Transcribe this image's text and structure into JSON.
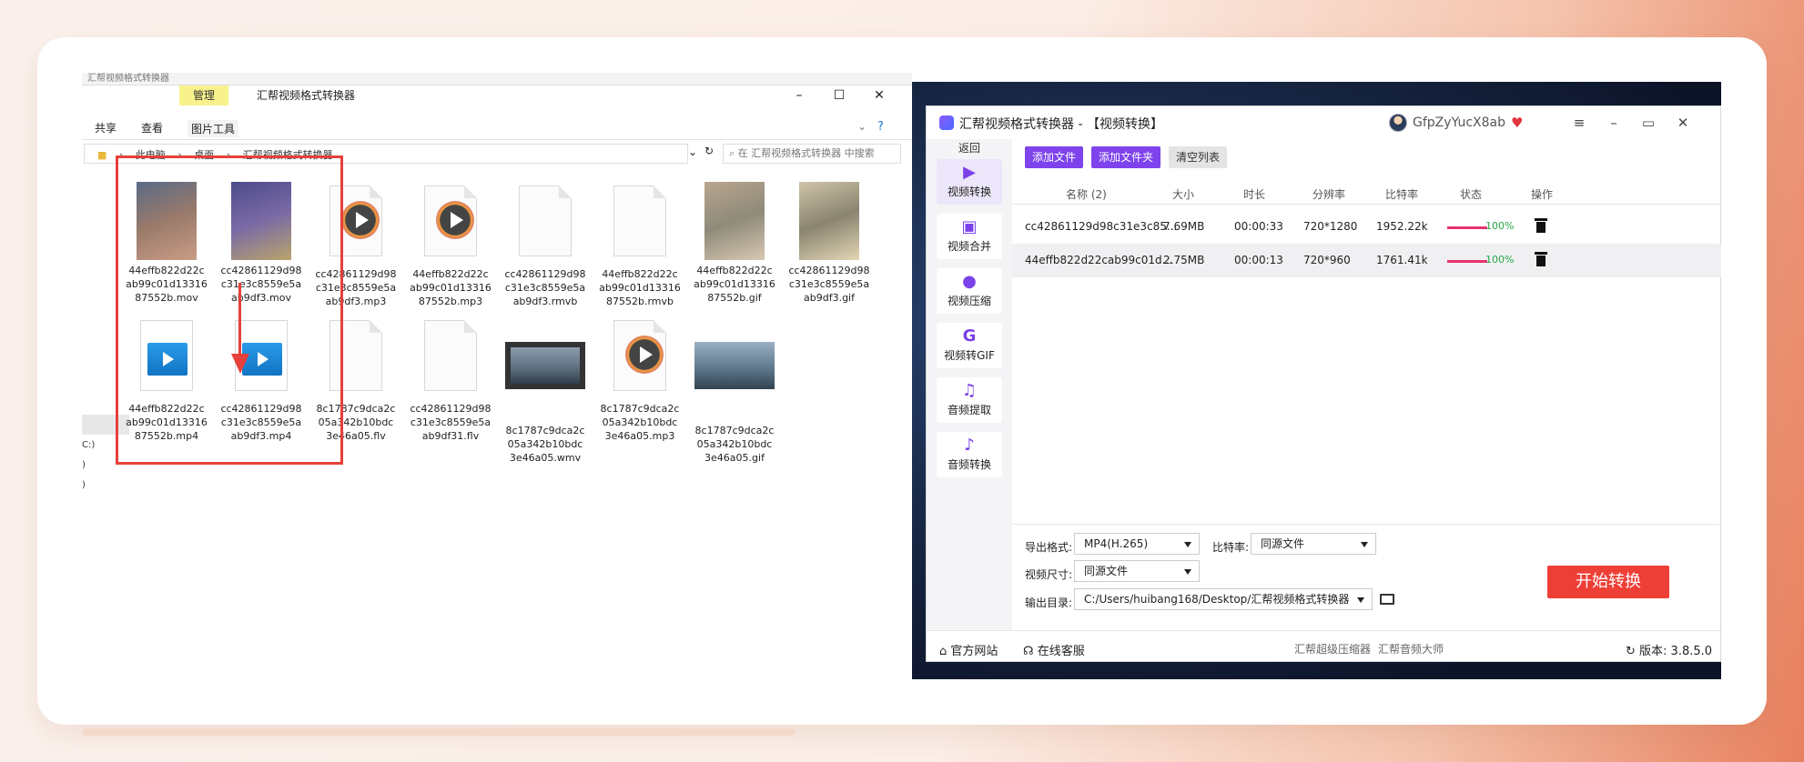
{
  "explorer": {
    "top_fragment": "汇帮视频格式转换器",
    "tab_manage": "管理",
    "title": "汇帮视频格式转换器",
    "ribbon": [
      "共享",
      "查看",
      "图片工具"
    ],
    "address": [
      "此电脑",
      "桌面",
      "汇帮视频格式转换器"
    ],
    "search_placeholder": "在 汇帮视频格式转换器 中搜索",
    "side_fragments": [
      "C:)",
      ")",
      ")"
    ],
    "files": [
      {
        "name": "44effb822d22cab99c01d1331687552b.mov",
        "lines": [
          "44effb822d22c",
          "ab99c01d13316",
          "87552b.mov"
        ],
        "kind": "photo",
        "colors": [
          "#5a6b86",
          "#9a7a6a",
          "#c99d86"
        ]
      },
      {
        "name": "cc42861129d98c31e3c8559e5aab9df3.mov",
        "lines": [
          "cc42861129d98",
          "c31e3c8559e5a",
          "ab9df3.mov"
        ],
        "kind": "photo",
        "colors": [
          "#4d4b8a",
          "#7a6aa6",
          "#b9a46a"
        ]
      },
      {
        "name": "cc42861129d98c31e3c8559e5aab9df3.mp3",
        "lines": [
          "cc42861129d98",
          "c31e3c8559e5a",
          "ab9df3.mp3"
        ],
        "kind": "play"
      },
      {
        "name": "44effb822d22cab99c01d1331687552b.mp3",
        "lines": [
          "44effb822d22c",
          "ab99c01d13316",
          "87552b.mp3"
        ],
        "kind": "play"
      },
      {
        "name": "cc42861129d98c31e3c8559e5aab9df3.rmvb",
        "lines": [
          "cc42861129d98",
          "c31e3c8559e5a",
          "ab9df3.rmvb"
        ],
        "kind": "doc"
      },
      {
        "name": "44effb822d22cab99c01d1331687552b.rmvb",
        "lines": [
          "44effb822d22c",
          "ab99c01d13316",
          "87552b.rmvb"
        ],
        "kind": "doc"
      },
      {
        "name": "44effb822d22cab99c01d1331687552b.gif",
        "lines": [
          "44effb822d22c",
          "ab99c01d13316",
          "87552b.gif"
        ],
        "kind": "photo",
        "colors": [
          "#b9a68e",
          "#8f8a7a",
          "#d8c8b2"
        ]
      },
      {
        "name": "cc42861129d98c31e3c8559e5aab9df3.gif",
        "lines": [
          "cc42861129d98",
          "c31e3c8559e5a",
          "ab9df3.gif"
        ],
        "kind": "photo",
        "colors": [
          "#cfc4a8",
          "#8a8470",
          "#e3d6b5"
        ]
      },
      {
        "name": "44effb822d22cab99c01d1331687552b.mp4",
        "lines": [
          "44effb822d22c",
          "ab99c01d13316",
          "87552b.mp4"
        ],
        "kind": "mp4"
      },
      {
        "name": "cc42861129d98c31e3c8559e5aab9df3.mp4",
        "lines": [
          "cc42861129d98",
          "c31e3c8559e5a",
          "ab9df3.mp4"
        ],
        "kind": "mp4"
      },
      {
        "name": "8c1787c9dca2c05a342b10bdc3e46a05.flv",
        "lines": [
          "8c1787c9dca2c",
          "05a342b10bdc",
          "3e46a05.flv"
        ],
        "kind": "doc"
      },
      {
        "name": "cc42861129d98c31e3c8559e5aab9df31.flv",
        "lines": [
          "cc42861129d98",
          "c31e3c8559e5a",
          "ab9df31.flv"
        ],
        "kind": "doc"
      },
      {
        "name": "8c1787c9dca2c05a342b10bdc3e46a05.wmv",
        "lines": [
          "8c1787c9dca2c",
          "05a342b10bdc",
          "3e46a05.wmv"
        ],
        "kind": "film"
      },
      {
        "name": "8c1787c9dca2c05a342b10bdc3e46a05.mp3",
        "lines": [
          "8c1787c9dca2c",
          "05a342b10bdc",
          "3e46a05.mp3"
        ],
        "kind": "play"
      },
      {
        "name": "8c1787c9dca2c05a342b10bdc3e46a05.gif",
        "lines": [
          "8c1787c9dca2c",
          "05a342b10bdc",
          "3e46a05.gif"
        ],
        "kind": "widephoto"
      }
    ]
  },
  "app": {
    "title": "汇帮视频格式转换器  - 【视频转换】",
    "username": "GfpZyYucX8ab",
    "back": "返回",
    "nav": [
      {
        "label": "视频转换",
        "icon": "video-convert-icon",
        "glyph": "▶",
        "active": true
      },
      {
        "label": "视频合并",
        "icon": "video-merge-icon",
        "glyph": "▣",
        "active": false
      },
      {
        "label": "视频压缩",
        "icon": "video-compress-icon",
        "glyph": "●",
        "active": false
      },
      {
        "label": "视频转GIF",
        "icon": "video-gif-icon",
        "glyph": "G",
        "active": false
      },
      {
        "label": "音频提取",
        "icon": "music-note-icon",
        "glyph": "♫",
        "active": false
      },
      {
        "label": "音频转换",
        "icon": "microphone-icon",
        "glyph": "♪",
        "active": false
      }
    ],
    "buttons": {
      "add_file": "添加文件",
      "add_folder": "添加文件夹",
      "clear": "清空列表"
    },
    "columns": [
      "名称 (2)",
      "大小",
      "时长",
      "分辨率",
      "比特率",
      "状态",
      "操作"
    ],
    "rows": [
      {
        "name": "cc42861129d98c31e3c85...",
        "size": "7.69MB",
        "duration": "00:00:33",
        "resolution": "720*1280",
        "bitrate": "1952.22k",
        "progress": "100%"
      },
      {
        "name": "44effb822d22cab99c01d...",
        "size": "2.75MB",
        "duration": "00:00:13",
        "resolution": "720*960",
        "bitrate": "1761.41k",
        "progress": "100%"
      }
    ],
    "settings": {
      "format_label": "导出格式:",
      "format_value": "MP4(H.265)",
      "bitrate_label": "比特率:",
      "bitrate_value": "同源文件",
      "size_label": "视频尺寸:",
      "size_value": "同源文件",
      "output_label": "输出目录:",
      "output_value": "C:/Users/huibang168/Desktop/汇帮视频格式转换器"
    },
    "start_button": "开始转换",
    "footer": {
      "website": "官方网站",
      "service": "在线客服",
      "link1": "汇帮超级压缩器",
      "link2": "汇帮音频大师",
      "version": "版本: 3.8.5.0"
    },
    "accent": "#7e43ec",
    "start_color": "#ee3f36"
  }
}
